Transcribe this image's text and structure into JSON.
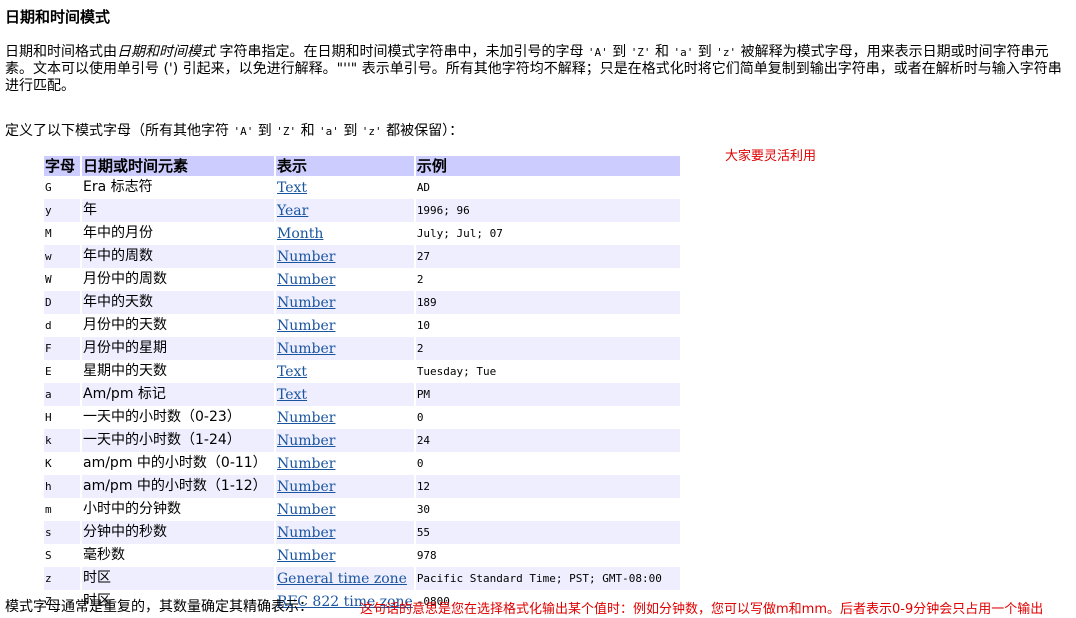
{
  "title": "日期和时间模式",
  "intro": {
    "p1": "日期和时间格式由",
    "p1_em": "日期和时间模式",
    "p2": "字符串指定。在日期和时间模式字符串中，未加引号的字母",
    "q_A": "'A'",
    "to1": "到",
    "q_Z": "'Z'",
    "and1": "和",
    "q_a": "'a'",
    "to2": "到",
    "q_z": "'z'",
    "p3": "被解释为模式字母，用来表示日期或时间字符串元素。文本可以使用单引号 (') 引起来，以免进行解释。\"''\" 表示单引号。所有其他字符均不解释；只是在格式化时将它们简单复制到输出字符串，或者在解析时与输入字符串进行匹配。"
  },
  "defined": {
    "p1": "定义了以下模式字母（所有其他字符",
    "q_A": "'A'",
    "to1": "到",
    "q_Z": "'Z'",
    "and1": "和",
    "q_a": "'a'",
    "to2": "到",
    "q_z": "'z'",
    "p2": "都被保留）："
  },
  "note_right": "大家要灵活利用",
  "table": {
    "headers": [
      "字母",
      "日期或时间元素",
      "表示",
      "示例"
    ],
    "rows": [
      {
        "letter": "G",
        "element": "Era 标志符",
        "presentation": "Text",
        "example": "AD"
      },
      {
        "letter": "y",
        "element": "年",
        "presentation": "Year",
        "example": "1996; 96"
      },
      {
        "letter": "M",
        "element": "年中的月份",
        "presentation": "Month",
        "example": "July; Jul; 07"
      },
      {
        "letter": "w",
        "element": "年中的周数",
        "presentation": "Number",
        "example": "27"
      },
      {
        "letter": "W",
        "element": "月份中的周数",
        "presentation": "Number",
        "example": "2"
      },
      {
        "letter": "D",
        "element": "年中的天数",
        "presentation": "Number",
        "example": "189"
      },
      {
        "letter": "d",
        "element": "月份中的天数",
        "presentation": "Number",
        "example": "10"
      },
      {
        "letter": "F",
        "element": "月份中的星期",
        "presentation": "Number",
        "example": "2"
      },
      {
        "letter": "E",
        "element": "星期中的天数",
        "presentation": "Text",
        "example": "Tuesday; Tue"
      },
      {
        "letter": "a",
        "element": "Am/pm 标记",
        "presentation": "Text",
        "example": "PM"
      },
      {
        "letter": "H",
        "element": "一天中的小时数（0-23）",
        "presentation": "Number",
        "example": "0"
      },
      {
        "letter": "k",
        "element": "一天中的小时数（1-24）",
        "presentation": "Number",
        "example": "24"
      },
      {
        "letter": "K",
        "element": "am/pm 中的小时数（0-11）",
        "presentation": "Number",
        "example": "0"
      },
      {
        "letter": "h",
        "element": "am/pm 中的小时数（1-12）",
        "presentation": "Number",
        "example": "12"
      },
      {
        "letter": "m",
        "element": "小时中的分钟数",
        "presentation": "Number",
        "example": "30"
      },
      {
        "letter": "s",
        "element": "分钟中的秒数",
        "presentation": "Number",
        "example": "55"
      },
      {
        "letter": "S",
        "element": "毫秒数",
        "presentation": "Number",
        "example": "978"
      },
      {
        "letter": "z",
        "element": "时区",
        "presentation": "General time zone",
        "example": "Pacific Standard Time; PST; GMT-08:00"
      },
      {
        "letter": "Z",
        "element": "时区",
        "presentation": "RFC 822 time zone",
        "example": "-0800"
      }
    ]
  },
  "bottom_text": "模式字母通常是重复的，其数量确定其精确表示：",
  "note_bottom": "这句话的意思是您在选择格式化输出某个值时：例如分钟数，您可以写做m和mm。后者表示0-9分钟会只占用一个输出",
  "colors": {
    "header_bg": "#ccccff",
    "alt_row_bg": "#eeeeff",
    "link": "#1a55a0",
    "note": "#e00000"
  }
}
